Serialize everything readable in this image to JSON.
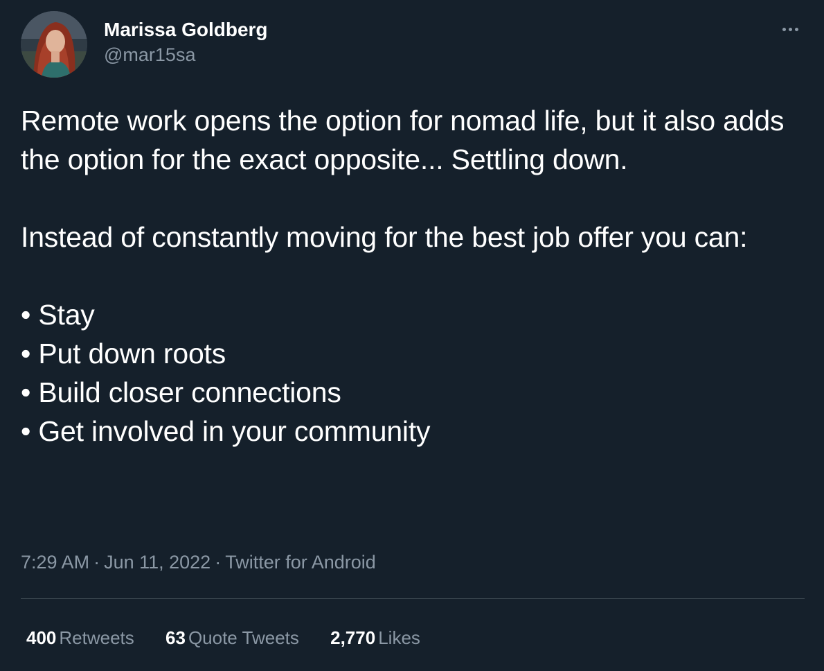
{
  "author": {
    "display_name": "Marissa Goldberg",
    "handle": "@mar15sa"
  },
  "more_icon": "more-horizontal-icon",
  "tweet": {
    "paragraph_1": "Remote work opens the option for nomad life, but it also adds the option for the exact opposite... Settling down.",
    "paragraph_2": "Instead of constantly moving for the best job offer you can:",
    "bullets": [
      "Stay",
      "Put down roots",
      "Build closer connections",
      "Get involved in your community"
    ]
  },
  "meta": {
    "time": "7:29 AM",
    "date": "Jun 11, 2022",
    "source": "Twitter for Android",
    "separator": "·"
  },
  "stats": [
    {
      "count": "400",
      "label": "Retweets"
    },
    {
      "count": "63",
      "label": "Quote Tweets"
    },
    {
      "count": "2,770",
      "label": "Likes"
    }
  ],
  "colors": {
    "background": "#15202b",
    "text_primary": "#ffffff",
    "text_secondary": "#8b98a5",
    "divider": "#38444d"
  }
}
